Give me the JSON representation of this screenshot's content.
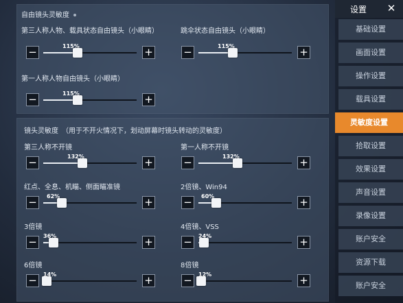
{
  "free_look": {
    "title": "自由镜头灵敏度",
    "controls": [
      {
        "label": "第三人称人物、载具状态自由镜头（小眼睛）",
        "percent": "115%",
        "value": 0.37
      },
      {
        "label": "跳伞状态自由镜头（小眼睛）",
        "percent": "115%",
        "value": 0.37
      },
      {
        "label": "第一人称人物自由镜头（小眼睛）",
        "percent": "115%",
        "value": 0.37
      }
    ]
  },
  "camera": {
    "title": "镜头灵敏度　（用于不开火情况下，划动屏幕时镜头转动的灵敏度）",
    "controls": [
      {
        "label": "第三人称不开镜",
        "percent": "132%",
        "value": 0.42
      },
      {
        "label": "第一人称不开镜",
        "percent": "132%",
        "value": 0.42
      },
      {
        "label": "红点、全息、机瞄、侧面瞄准镜",
        "percent": "62%",
        "value": 0.2
      },
      {
        "label": "2倍镜、Win94",
        "percent": "60%",
        "value": 0.19
      },
      {
        "label": "3倍镜",
        "percent": "36%",
        "value": 0.11
      },
      {
        "label": "4倍镜、VSS",
        "percent": "24%",
        "value": 0.06
      },
      {
        "label": "6倍镜",
        "percent": "14%",
        "value": 0.04
      },
      {
        "label": "8倍镜",
        "percent": "12%",
        "value": 0.03
      }
    ]
  },
  "buttons": {
    "minus": "−",
    "plus": "+"
  },
  "sidebar": {
    "title": "设置",
    "close": "✕",
    "items": [
      {
        "label": "基础设置"
      },
      {
        "label": "画面设置"
      },
      {
        "label": "操作设置"
      },
      {
        "label": "载具设置"
      },
      {
        "label": "灵敏度设置",
        "active": true
      },
      {
        "label": "拾取设置"
      },
      {
        "label": "效果设置"
      },
      {
        "label": "声音设置"
      },
      {
        "label": "录像设置"
      },
      {
        "label": "账户安全"
      },
      {
        "label": "资源下载"
      },
      {
        "label": "账户安全"
      }
    ]
  },
  "colors": {
    "accent": "#e8892c"
  }
}
